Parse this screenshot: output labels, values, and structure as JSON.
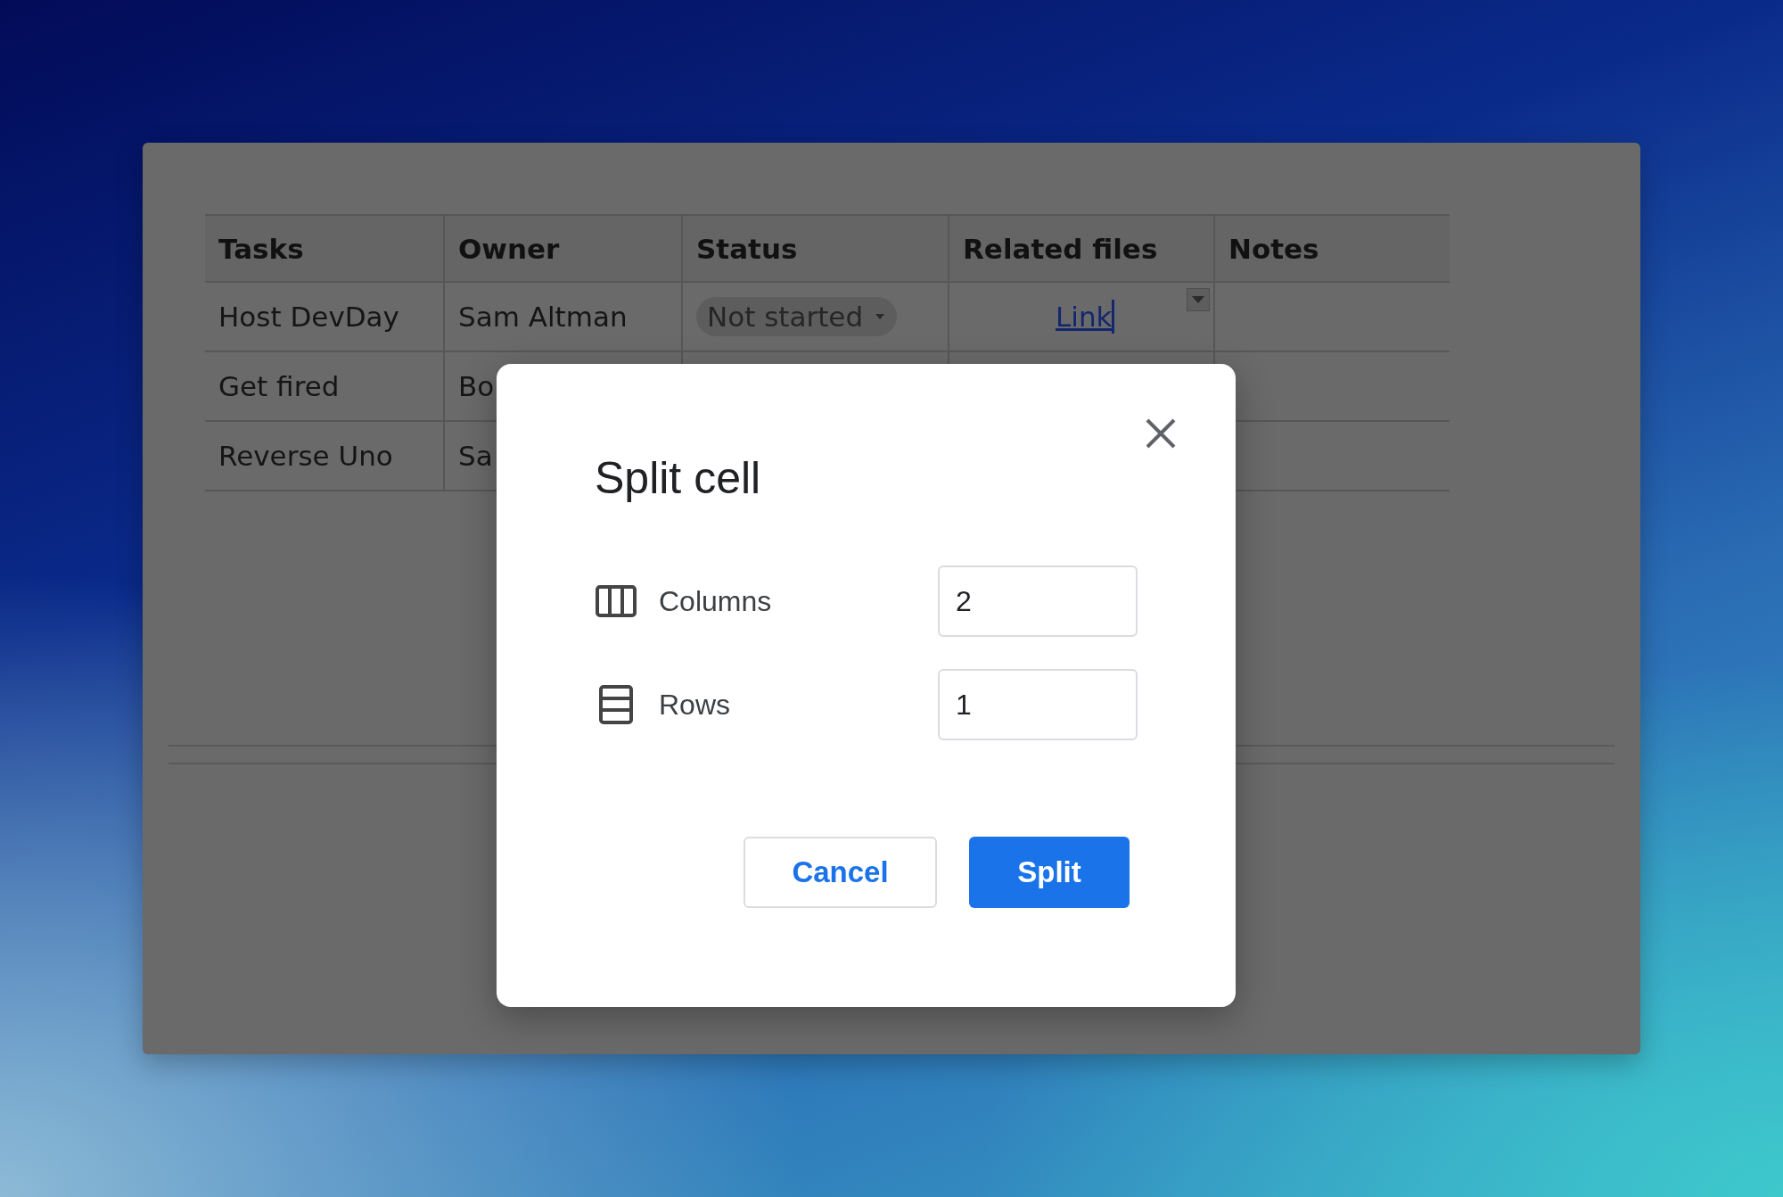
{
  "document": {
    "table": {
      "columns": [
        "Tasks",
        "Owner",
        "Status",
        "Related files",
        "Notes"
      ],
      "rows": [
        {
          "cells": [
            {
              "kind": "text",
              "text": "Host DevDay"
            },
            {
              "kind": "text",
              "text": "Sam Altman"
            },
            {
              "kind": "status",
              "text": "Not started"
            },
            {
              "kind": "link",
              "text": "Link"
            }
          ]
        },
        {
          "cells": [
            {
              "kind": "text",
              "text": "Get fired"
            },
            {
              "kind": "text",
              "text": "Bo"
            }
          ]
        },
        {
          "cells": [
            {
              "kind": "text",
              "text": "Reverse Uno"
            },
            {
              "kind": "text",
              "text": "Sa"
            }
          ]
        }
      ]
    }
  },
  "dialog": {
    "title": "Split cell",
    "fields": [
      {
        "kind": "columns",
        "label": "Columns",
        "value": "2"
      },
      {
        "kind": "rows",
        "label": "Rows",
        "value": "1"
      }
    ],
    "buttons": [
      {
        "kind": "secondary",
        "label": "Cancel"
      },
      {
        "kind": "primary",
        "label": "Split"
      }
    ]
  }
}
